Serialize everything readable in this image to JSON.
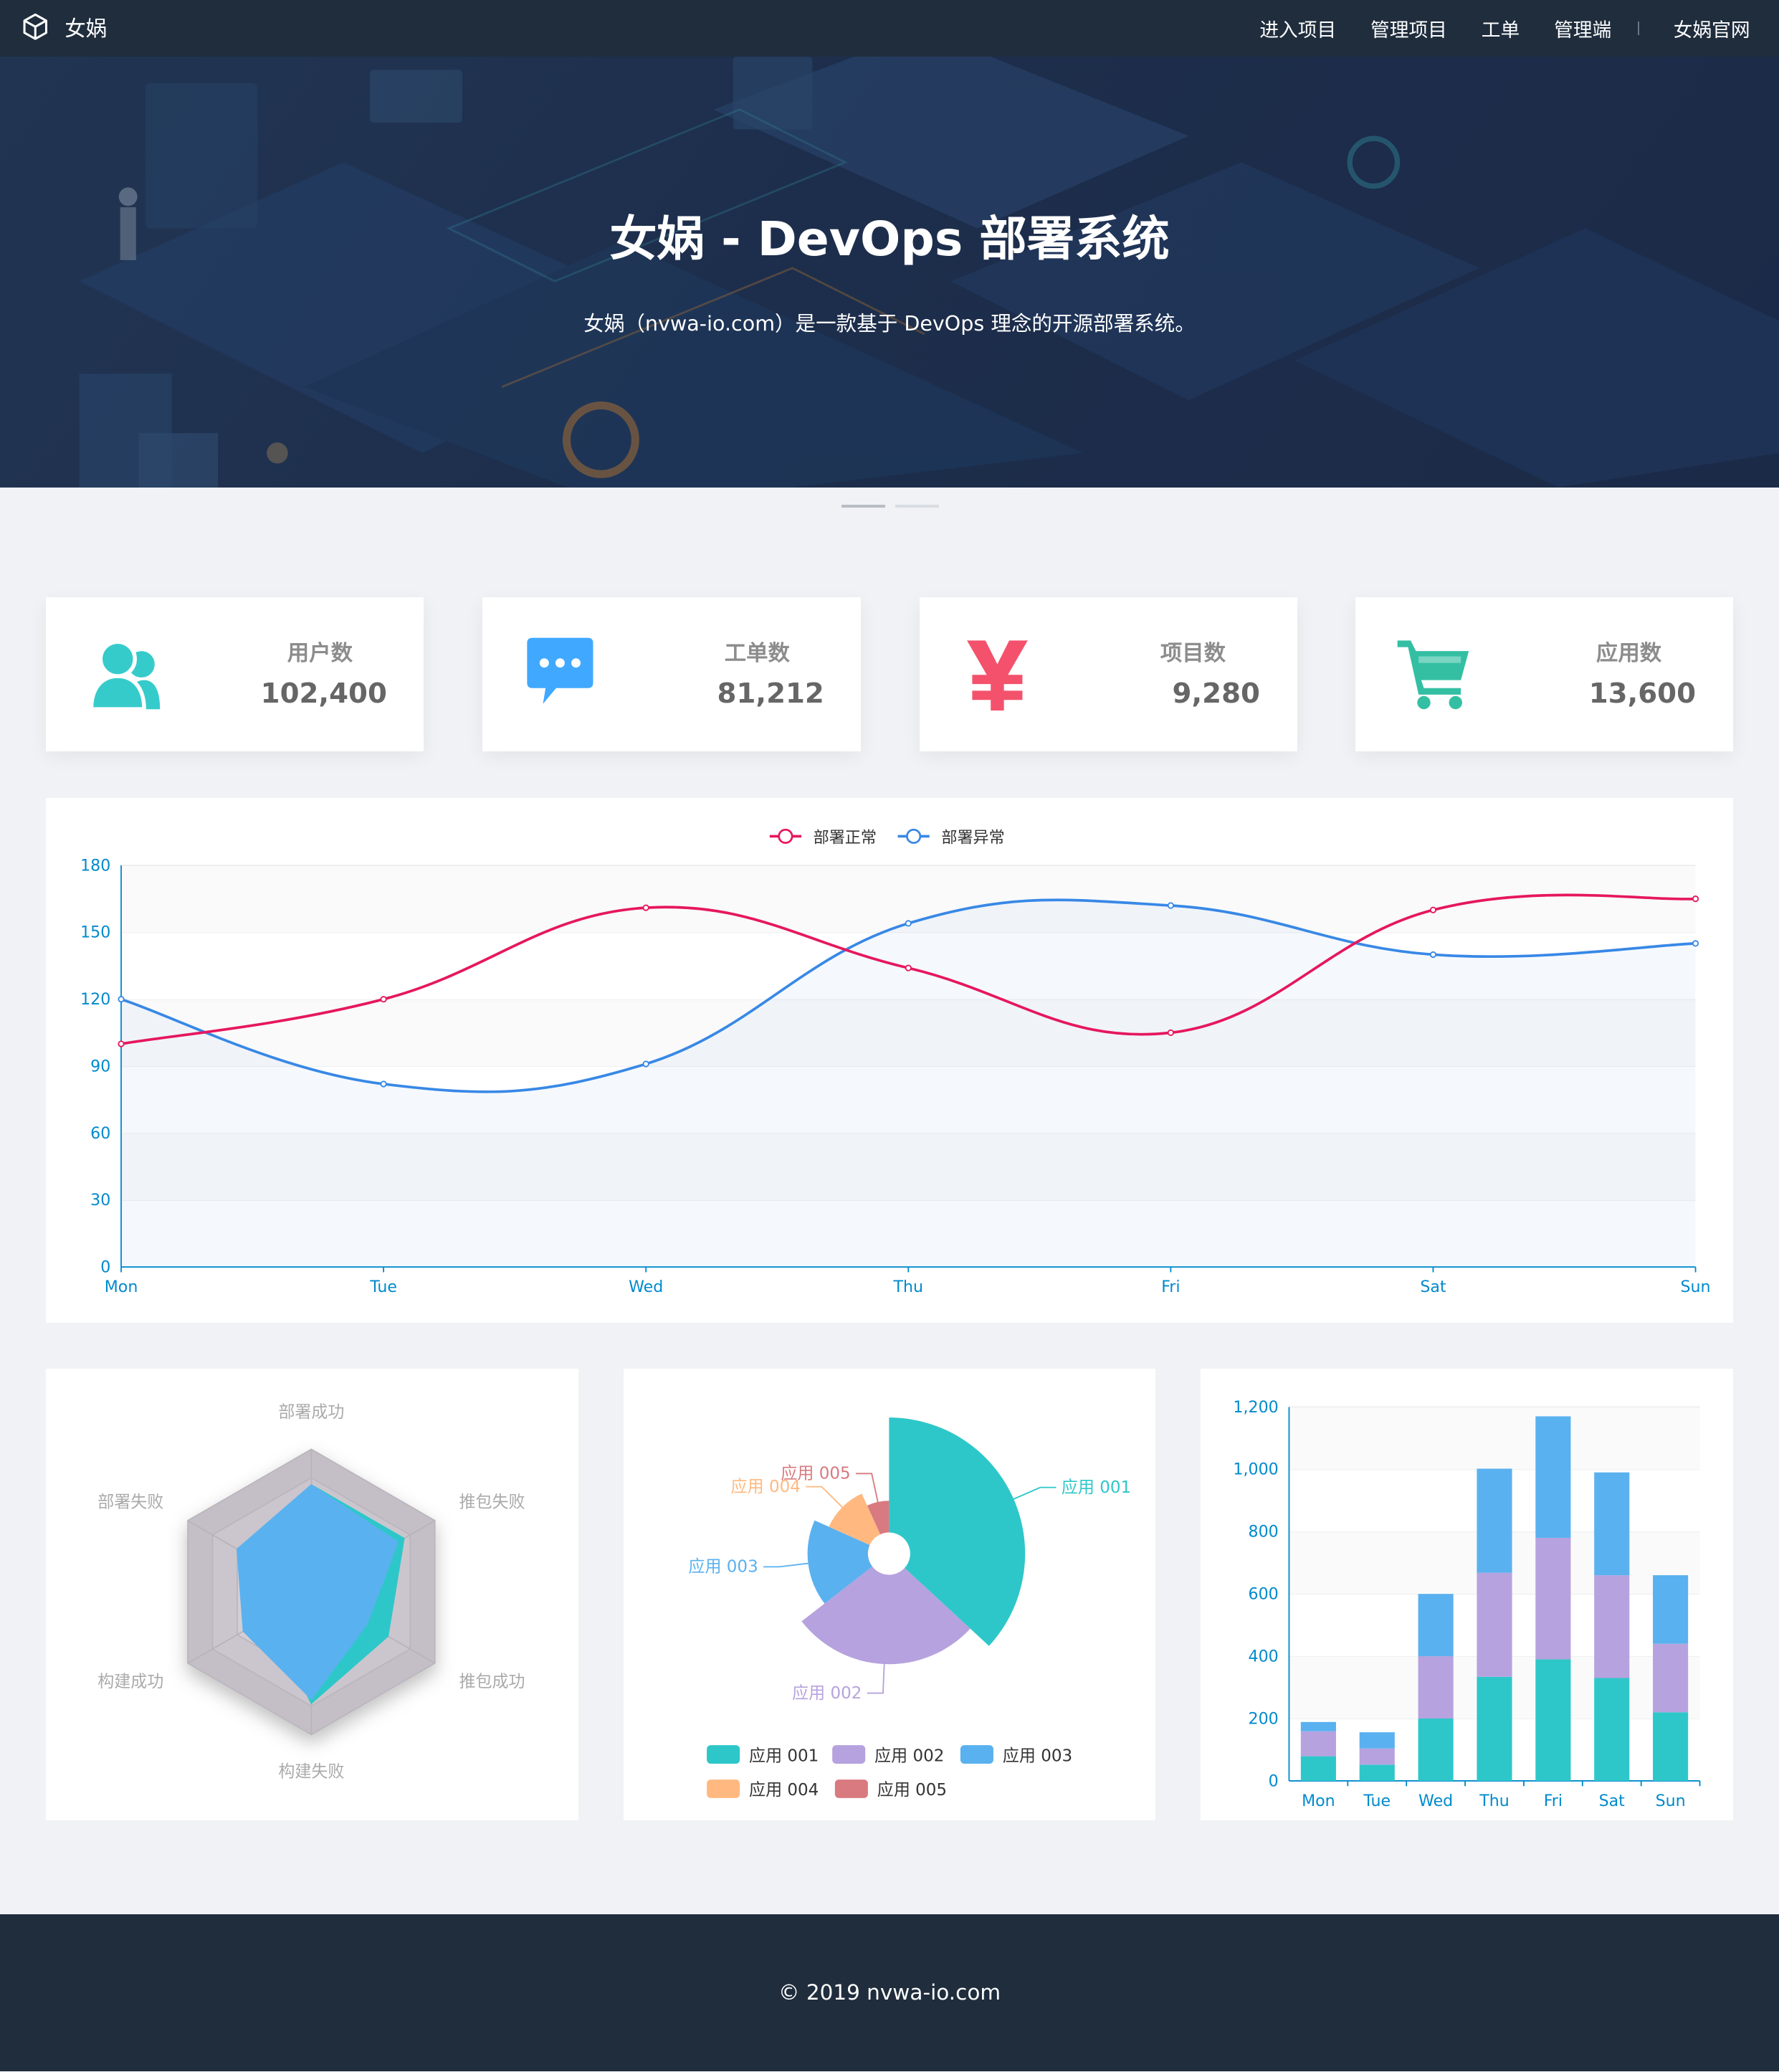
{
  "header": {
    "brand": "女娲",
    "nav": [
      "进入项目",
      "管理项目",
      "工单",
      "管理端",
      "女娲官网"
    ]
  },
  "banner": {
    "title": "女娲 - DevOps 部署系统",
    "subtitle": "女娲（nvwa-io.com）是一款基于 DevOps 理念的开源部署系统。",
    "slides": 2,
    "active_slide": 1
  },
  "stats": [
    {
      "label": "用户数",
      "value": "102,400",
      "icon": "users-icon",
      "color": "#36cbcb"
    },
    {
      "label": "工单数",
      "value": "81,212",
      "icon": "message-icon",
      "color": "#40a9ff"
    },
    {
      "label": "项目数",
      "value": "9,280",
      "icon": "yen-icon",
      "color": "#f4516c"
    },
    {
      "label": "应用数",
      "value": "13,600",
      "icon": "shopping-cart-icon",
      "color": "#34bfa3"
    }
  ],
  "chart_data": [
    {
      "type": "line",
      "x": [
        "Mon",
        "Tue",
        "Wed",
        "Thu",
        "Fri",
        "Sat",
        "Sun"
      ],
      "series": [
        {
          "name": "部署正常",
          "color": "#e6175d",
          "values": [
            100,
            120,
            161,
            134,
            105,
            160,
            165
          ]
        },
        {
          "name": "部署异常",
          "color": "#3888e6",
          "values": [
            120,
            82,
            91,
            154,
            162,
            140,
            145
          ]
        }
      ],
      "ylim": [
        0,
        180
      ],
      "yticks": [
        0,
        30,
        60,
        90,
        120,
        150,
        180
      ],
      "legend": "top-center",
      "grid": true
    },
    {
      "type": "radar",
      "indicators": [
        "部署成功",
        "推包失败",
        "推包成功",
        "构建失败",
        "构建成功",
        "部署失败"
      ],
      "max": 100,
      "series": [
        {
          "color": "#b6a2de",
          "values": [
            50,
            40,
            42,
            75,
            55,
            35
          ]
        },
        {
          "color": "#2ec7c9",
          "values": [
            75,
            75,
            62,
            78,
            35,
            35
          ]
        },
        {
          "color": "#5ab1ef",
          "values": [
            75,
            70,
            45,
            75,
            55,
            60
          ]
        }
      ]
    },
    {
      "type": "pie",
      "variant": "rose",
      "series": [
        {
          "name": "应用 001",
          "value": 320,
          "color": "#2ec7c9"
        },
        {
          "name": "应用 002",
          "value": 240,
          "color": "#b6a2de"
        },
        {
          "name": "应用 003",
          "value": 149,
          "color": "#5ab1ef"
        },
        {
          "name": "应用 004",
          "value": 100,
          "color": "#ffb980"
        },
        {
          "name": "应用 005",
          "value": 59,
          "color": "#d87a80"
        }
      ],
      "legend": "bottom"
    },
    {
      "type": "bar",
      "stacked": true,
      "categories": [
        "Mon",
        "Tue",
        "Wed",
        "Thu",
        "Fri",
        "Sat",
        "Sun"
      ],
      "series": [
        {
          "color": "#2ec7c9",
          "values": [
            79,
            52,
            200,
            334,
            390,
            330,
            220
          ]
        },
        {
          "color": "#b6a2de",
          "values": [
            80,
            52,
            200,
            334,
            390,
            330,
            220
          ]
        },
        {
          "color": "#5ab1ef",
          "values": [
            30,
            52,
            200,
            334,
            390,
            330,
            220
          ]
        }
      ],
      "ylim": [
        0,
        1200
      ],
      "yticks": [
        "0",
        "200",
        "400",
        "600",
        "800",
        "1,000",
        "1,200"
      ],
      "grid": true
    }
  ],
  "footer": {
    "copyright": "© 2019 nvwa-io.com"
  }
}
